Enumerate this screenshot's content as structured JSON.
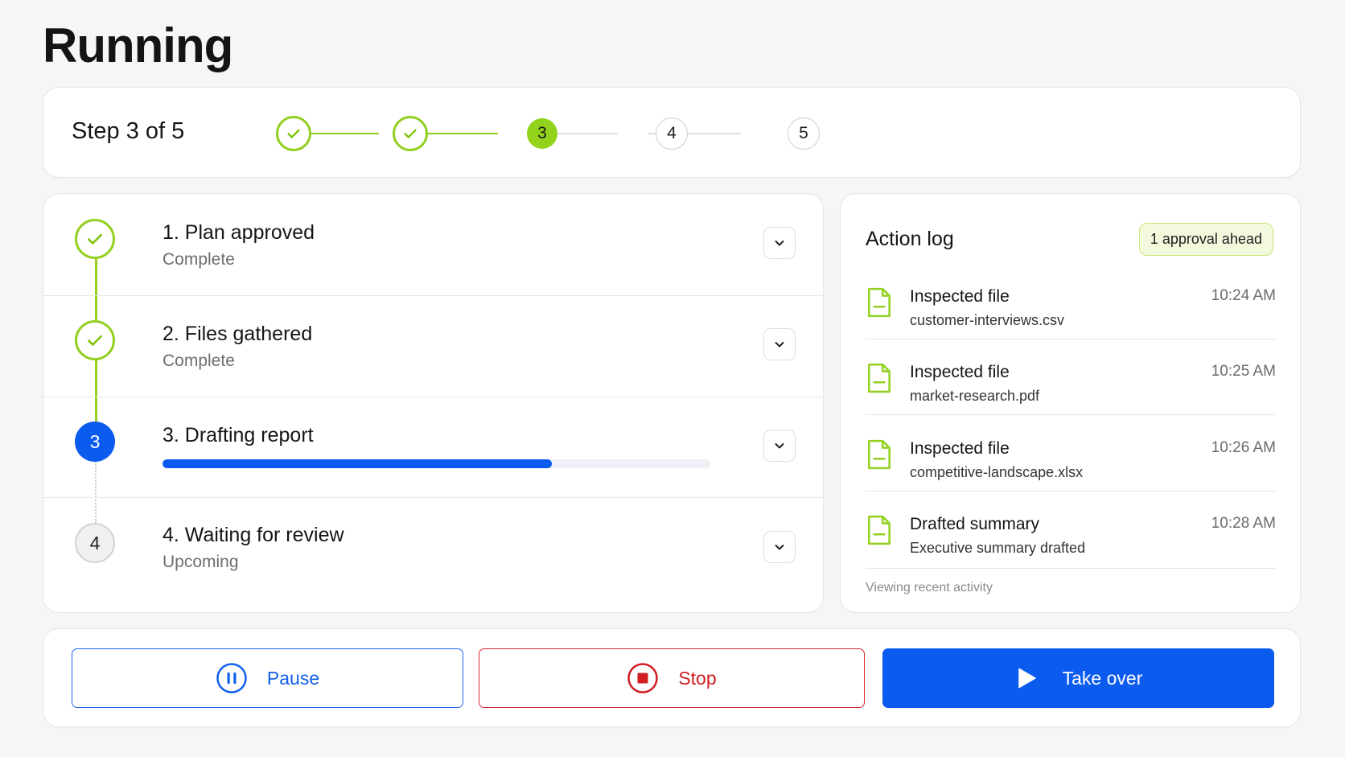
{
  "page": {
    "title": "Running"
  },
  "stepper": {
    "label": "Step 3 of 5",
    "nodes": [
      {
        "state": "done",
        "text": ""
      },
      {
        "state": "done",
        "text": ""
      },
      {
        "state": "current",
        "text": "3"
      },
      {
        "state": "todo",
        "text": "4"
      },
      {
        "state": "todo",
        "text": "5"
      }
    ]
  },
  "steps": [
    {
      "number": "",
      "title": "1. Plan approved",
      "status": "Complete",
      "state": "done"
    },
    {
      "number": "",
      "title": "2. Files gathered",
      "status": "Complete",
      "state": "done"
    },
    {
      "number": "3",
      "title": "3. Drafting report",
      "status": "",
      "state": "current",
      "progress": 0.71
    },
    {
      "number": "4",
      "title": "4. Waiting for review",
      "status": "Upcoming",
      "state": "todo"
    }
  ],
  "action_log": {
    "title": "Action log",
    "badge": "1 approval ahead",
    "items": [
      {
        "action": "Inspected file",
        "detail": "customer-interviews.csv",
        "time": "10:24 AM",
        "icon": "file-icon"
      },
      {
        "action": "Inspected file",
        "detail": "market-research.pdf",
        "time": "10:25 AM",
        "icon": "file-icon"
      },
      {
        "action": "Inspected file",
        "detail": "competitive-landscape.xlsx",
        "time": "10:26 AM",
        "icon": "file-icon"
      },
      {
        "action": "Drafted summary",
        "detail": "Executive summary drafted",
        "time": "10:28 AM",
        "icon": "file-icon"
      }
    ],
    "footer": "Viewing recent activity"
  },
  "controls": {
    "pause_label": "Pause",
    "stop_label": "Stop",
    "take_over_label": "Take over"
  },
  "colors": {
    "accent_blue": "#0b5bef",
    "success_green": "#93d020",
    "danger_red": "#d7262a",
    "badge_bg": "#f2f9dc"
  }
}
